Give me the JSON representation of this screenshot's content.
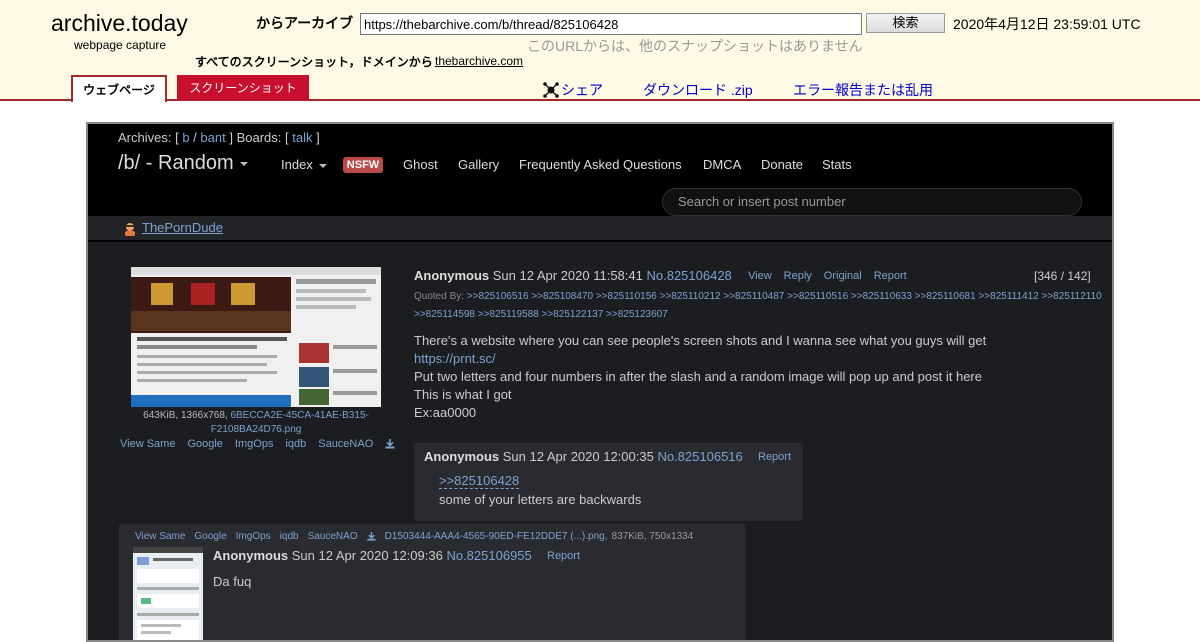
{
  "archive": {
    "logo_title": "archive.today",
    "logo_subtitle": "webpage capture",
    "from_label": "からアーカイブ",
    "url_value": "https://thebarchive.com/b/thread/825106428",
    "search_button": "検索",
    "capture_date": "2020年4月12日 23:59:01 UTC",
    "no_snapshots": "このURLからは、他のスナップショットはありません",
    "all_screenshots_label": "すべてのスクリーンショット，ドメインから",
    "domain_link": "thebarchive.com",
    "tabs": {
      "webpage": "ウェブページ",
      "screenshot": "スクリーンショット"
    },
    "actions": {
      "share": "シェア",
      "download": "ダウンロード .zip",
      "report": "エラー報告または乱用"
    }
  },
  "board": {
    "archives_label": "Archives: [",
    "archive_b": "b",
    "archive_bant": "bant",
    "boards_label": "] Boards: [",
    "board_talk": "talk",
    "close_bracket": "]",
    "slash": "/",
    "title": "/b/ - Random",
    "nav": {
      "index": "Index",
      "nsfw": "NSFW",
      "ghost": "Ghost",
      "gallery": "Gallery",
      "faq": "Frequently Asked Questions",
      "dmca": "DMCA",
      "donate": "Donate",
      "stats": "Stats"
    },
    "search_placeholder": "Search or insert post number",
    "user": "ThePornDude"
  },
  "op": {
    "file_info": "643KiB, 1366x768,",
    "file_name": "6BECCA2E-45CA-41AE-B315-F2108BA24D76.png",
    "tools": [
      "View Same",
      "Google",
      "ImgOps",
      "iqdb",
      "SauceNAO"
    ],
    "name": "Anonymous",
    "date": "Sun 12 Apr 2020 11:58:41",
    "number": "No.825106428",
    "actions": [
      "View",
      "Reply",
      "Original",
      "Report"
    ],
    "reply_count": "[346 / 142]",
    "quoted_by_label": "Quoted By:",
    "quoted_by": ">>825106516 >>825108470 >>825110156 >>825110212 >>825110487 >>825110516 >>825110633 >>825110681 >>825111412 >>825112110 >>825114598 >>825119588 >>825122137 >>825123607",
    "body": {
      "line1": "There's a website where you can see people's screen shots and I wanna see what you guys will get",
      "link": "https://prnt.sc/",
      "line3": "Put two letters and four numbers in after the slash and a random image will pop up and post it here",
      "line4": "This is what I got",
      "line5": "Ex:aa0000"
    }
  },
  "reply1": {
    "name": "Anonymous",
    "date": "Sun 12 Apr 2020 12:00:35",
    "number": "No.825106516",
    "report": "Report",
    "backlink": ">>825106428",
    "text": "some of your letters are backwards"
  },
  "reply2": {
    "tools": [
      "View Same",
      "Google",
      "ImgOps",
      "iqdb",
      "SauceNAO"
    ],
    "file_name": "D1503444-AAA4-4565-90ED-FE12DDE7 (...).png,",
    "file_meta": "837KiB, 750x1334",
    "name": "Anonymous",
    "date": "Sun 12 Apr 2020 12:09:36",
    "number": "No.825106955",
    "report": "Report",
    "text": "Da fuq"
  }
}
